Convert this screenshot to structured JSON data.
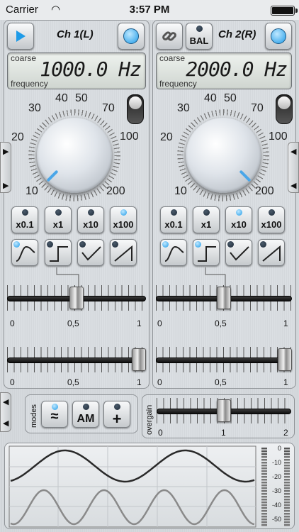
{
  "status_bar": {
    "carrier": "Carrier",
    "time": "3:57 PM"
  },
  "channel_left": {
    "title": "Ch 1(L)",
    "display": {
      "mode_label": "coarse",
      "param_label": "frequency",
      "value": "1000.0 Hz"
    },
    "knob_scale": [
      "10",
      "20",
      "30",
      "40",
      "50",
      "70",
      "100",
      "200"
    ],
    "multipliers": [
      {
        "label": "x0.1",
        "active": false
      },
      {
        "label": "x1",
        "active": false
      },
      {
        "label": "x10",
        "active": false
      },
      {
        "label": "x100",
        "active": true
      }
    ],
    "waveforms": [
      {
        "name": "sine",
        "active": true
      },
      {
        "name": "square",
        "active": false
      },
      {
        "name": "triangle",
        "active": false
      },
      {
        "name": "sawtooth",
        "active": false
      }
    ],
    "slider1": {
      "labels": [
        "0",
        "0,5",
        "1"
      ],
      "value": 0.5
    },
    "slider2": {
      "labels": [
        "0",
        "0,5",
        "1"
      ],
      "value": 1.0
    }
  },
  "channel_right": {
    "title": "Ch 2(R)",
    "bal_label": "BAL",
    "display": {
      "mode_label": "coarse",
      "param_label": "frequency",
      "value": "2000.0 Hz"
    },
    "knob_scale": [
      "10",
      "20",
      "30",
      "40",
      "50",
      "70",
      "100",
      "200"
    ],
    "multipliers": [
      {
        "label": "x0.1",
        "active": false
      },
      {
        "label": "x1",
        "active": false
      },
      {
        "label": "x10",
        "active": true
      },
      {
        "label": "x100",
        "active": false
      }
    ],
    "waveforms": [
      {
        "name": "sine",
        "active": true
      },
      {
        "name": "square",
        "active": true
      },
      {
        "name": "triangle",
        "active": false
      },
      {
        "name": "sawtooth",
        "active": false
      }
    ],
    "slider1": {
      "labels": [
        "0",
        "0,5",
        "1"
      ],
      "value": 0.5
    },
    "slider2": {
      "labels": [
        "0",
        "0,5",
        "1"
      ],
      "value": 1.0
    }
  },
  "modes": {
    "label": "modes",
    "buttons": [
      {
        "label": "≈",
        "active": true
      },
      {
        "label": "AM",
        "active": false
      },
      {
        "label": "+",
        "active": false
      }
    ]
  },
  "overgain": {
    "label": "overgain",
    "labels": [
      "0",
      "1",
      "2"
    ],
    "value": 1.0
  },
  "meter_labels": [
    "0",
    "-10",
    "-20",
    "-30",
    "-40",
    "-50"
  ],
  "colors": {
    "accent_blue": "#1e9be8",
    "lcd_bg": "#e3e9e4",
    "wave_top": "#2a2a2a",
    "wave_bottom": "#8a8a8a"
  }
}
